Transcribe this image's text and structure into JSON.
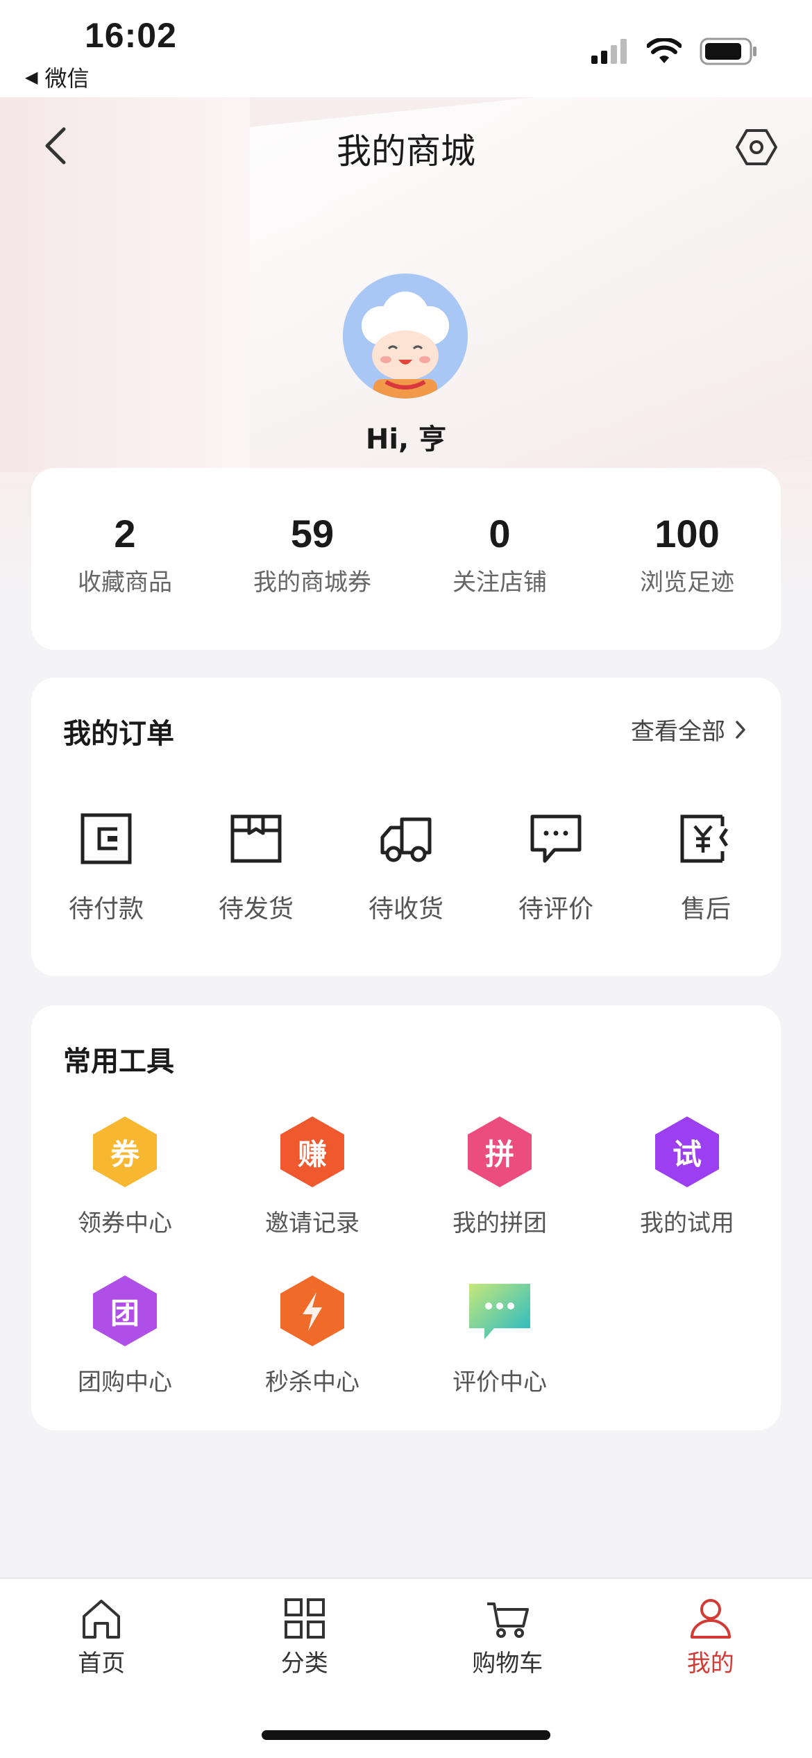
{
  "status_bar": {
    "time": "16:02",
    "back_app": "微信"
  },
  "header": {
    "title": "我的商城"
  },
  "user": {
    "greeting": "Hi, 亨"
  },
  "stats": [
    {
      "value": "2",
      "label": "收藏商品"
    },
    {
      "value": "59",
      "label": "我的商城券"
    },
    {
      "value": "0",
      "label": "关注店铺"
    },
    {
      "value": "100",
      "label": "浏览足迹"
    }
  ],
  "orders": {
    "title": "我的订单",
    "view_all": "查看全部",
    "items": [
      {
        "label": "待付款",
        "icon": "wallet-icon"
      },
      {
        "label": "待发货",
        "icon": "box-icon"
      },
      {
        "label": "待收货",
        "icon": "truck-icon"
      },
      {
        "label": "待评价",
        "icon": "comment-icon"
      },
      {
        "label": "售后",
        "icon": "refund-icon"
      }
    ]
  },
  "tools": {
    "title": "常用工具",
    "items": [
      {
        "label": "领券中心",
        "glyph": "券",
        "color": "#f7b731"
      },
      {
        "label": "邀请记录",
        "glyph": "赚",
        "color": "#f0582e"
      },
      {
        "label": "我的拼团",
        "glyph": "拼",
        "color": "#ea4d7e"
      },
      {
        "label": "我的试用",
        "glyph": "试",
        "color": "#9b3ff0"
      },
      {
        "label": "团购中心",
        "glyph": "团",
        "color": "#b04fe8"
      },
      {
        "label": "秒杀中心",
        "glyph": "",
        "color": "#f06a2a"
      },
      {
        "label": "评价中心",
        "glyph": "",
        "color": "#3cc8a8"
      }
    ]
  },
  "tabbar": {
    "items": [
      {
        "label": "首页"
      },
      {
        "label": "分类"
      },
      {
        "label": "购物车"
      },
      {
        "label": "我的"
      }
    ],
    "active_color": "#d23a35"
  }
}
